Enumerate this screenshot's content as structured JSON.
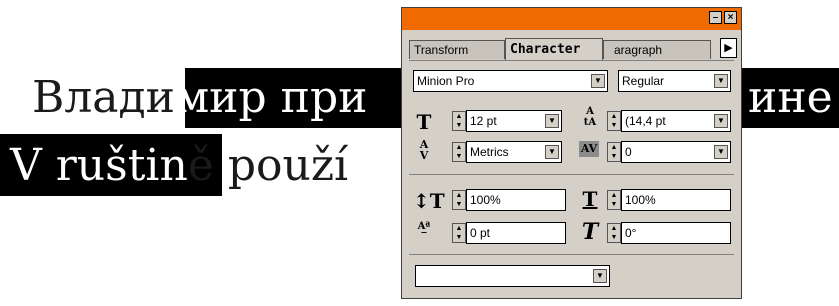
{
  "canvas": {
    "line1": [
      "Влади",
      "мир при",
      "ине"
    ],
    "line2": [
      "V ruštin",
      "ě použí"
    ]
  },
  "panel": {
    "title_controls": [
      "–",
      "×"
    ],
    "tabs": [
      "Transform",
      "Character",
      "aragraph"
    ],
    "tab_menu_icon": "▶",
    "font_family": "Minion Pro",
    "font_style": "Regular",
    "font_size": "12 pt",
    "leading": "(14,4 pt",
    "kerning": "Metrics",
    "tracking": "0",
    "vertical_scale": "100%",
    "horizontal_scale": "100%",
    "baseline_shift": "0 pt",
    "skew": "0°",
    "language": "",
    "icons": {
      "font_size": "font-size-icon",
      "leading": "leading-icon",
      "kerning": "kerning-icon",
      "tracking": "tracking-icon",
      "vertical_scale": "vertical-scale-icon",
      "horizontal_scale": "horizontal-scale-icon",
      "baseline_shift": "baseline-shift-icon",
      "skew": "skew-icon"
    },
    "colors": {
      "titlebar": "#f06a00",
      "panel_bg": "#d4d0c8"
    }
  }
}
